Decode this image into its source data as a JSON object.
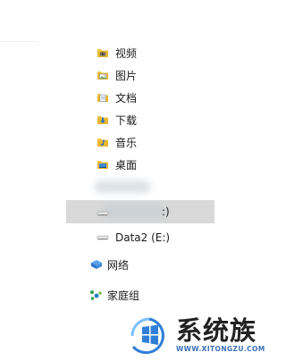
{
  "nav": {
    "items": [
      {
        "label": "视频",
        "icon": "video-folder-icon"
      },
      {
        "label": "图片",
        "icon": "pictures-folder-icon"
      },
      {
        "label": "文档",
        "icon": "documents-folder-icon"
      },
      {
        "label": "下载",
        "icon": "downloads-folder-icon"
      },
      {
        "label": "音乐",
        "icon": "music-folder-icon"
      },
      {
        "label": "桌面",
        "icon": "desktop-folder-icon"
      }
    ],
    "selected_drive": {
      "label": ":)",
      "icon": "drive-icon"
    },
    "data2_drive": {
      "label": "Data2 (E:)",
      "icon": "drive-icon"
    },
    "network": {
      "label": "网络",
      "icon": "network-icon"
    },
    "homegroup": {
      "label": "家庭组",
      "icon": "homegroup-icon"
    }
  },
  "watermark": {
    "brand": "系统族",
    "url": "WWW.XITONGZU.COM",
    "icon": "windows-logo-icon"
  },
  "colors": {
    "selected_bg": "#d9d9d9",
    "folder_yellow": "#f3c544",
    "watermark_blue": "#2f7ed8"
  }
}
